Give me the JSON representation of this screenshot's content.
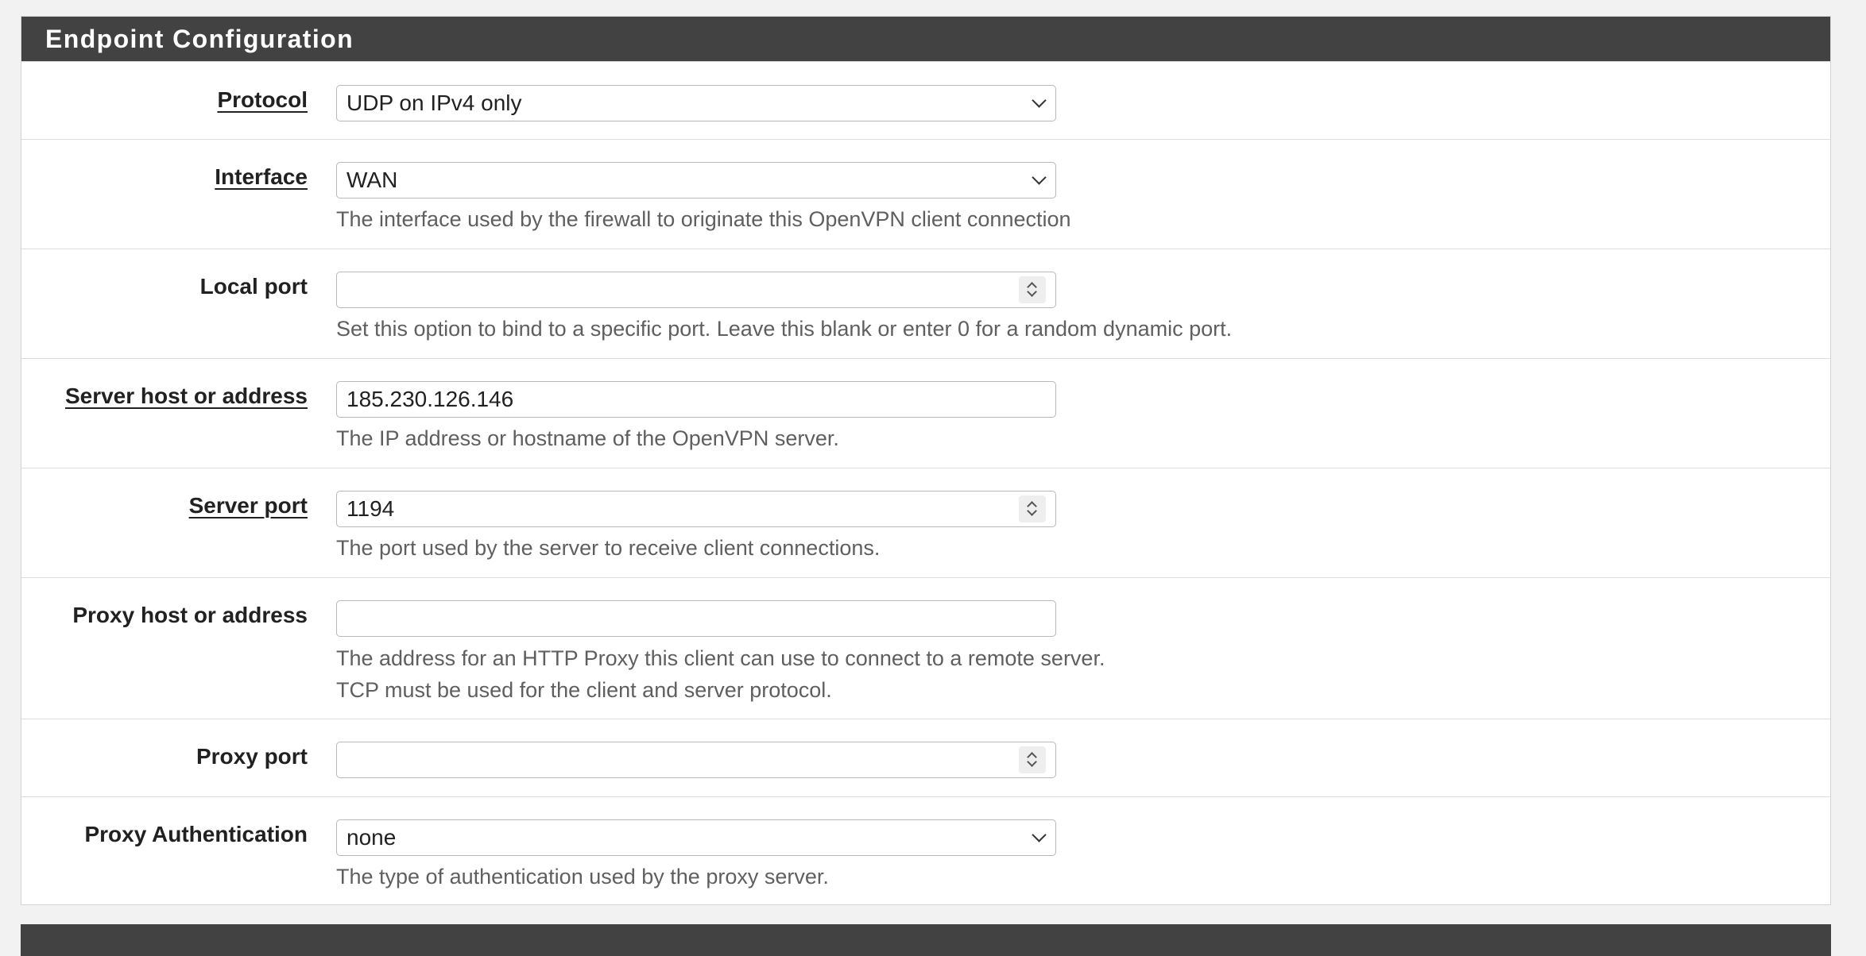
{
  "panel": {
    "title": "Endpoint Configuration"
  },
  "rows": {
    "protocol": {
      "label": "Protocol",
      "value": "UDP on IPv4 only"
    },
    "interface": {
      "label": "Interface",
      "value": "WAN",
      "help": "The interface used by the firewall to originate this OpenVPN client connection"
    },
    "local_port": {
      "label": "Local port",
      "value": "",
      "help": "Set this option to bind to a specific port. Leave this blank or enter 0 for a random dynamic port."
    },
    "server_host": {
      "label": "Server host or address",
      "value": "185.230.126.146",
      "help": "The IP address or hostname of the OpenVPN server."
    },
    "server_port": {
      "label": "Server port",
      "value": "1194",
      "help": "The port used by the server to receive client connections."
    },
    "proxy_host": {
      "label": "Proxy host or address",
      "value": "",
      "help_line1": "The address for an HTTP Proxy this client can use to connect to a remote server.",
      "help_line2": "TCP must be used for the client and server protocol."
    },
    "proxy_port": {
      "label": "Proxy port",
      "value": ""
    },
    "proxy_auth": {
      "label": "Proxy Authentication",
      "value": "none",
      "help": "The type of authentication used by the proxy server."
    }
  },
  "icons": {
    "select_chevron": "chevron-down-icon",
    "number_spinner": "spinner-arrows-icon"
  },
  "colors": {
    "heading_bg": "#424242",
    "heading_text": "#ffffff",
    "help_text": "#5f5f5f",
    "page_bg": "#f2f2f2"
  }
}
